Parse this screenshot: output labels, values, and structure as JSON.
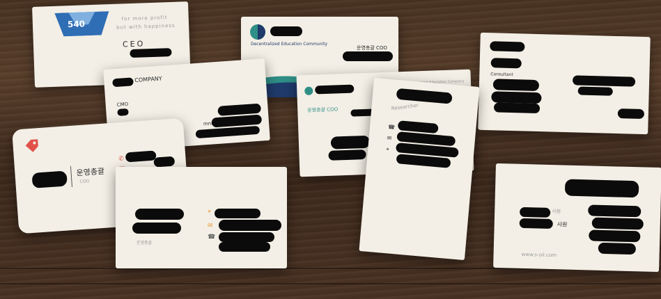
{
  "cards": {
    "card1": {
      "logo_text": "540",
      "role": "CEO",
      "slogan_1": "for more profit",
      "slogan_2": "but with happiness"
    },
    "card2": {
      "company_label": "COMPANY",
      "role": "CMO",
      "handle": "mnm"
    },
    "card3": {
      "org_caption": "Decentralized Education Community",
      "role": "운영총괄 COO"
    },
    "card4": {
      "role": "운영총괄 COO",
      "org_caption": "Decentralized Education Company"
    },
    "card5": {
      "role": "Researcher"
    },
    "card6": {
      "role": "Consultant"
    },
    "card7": {
      "role_ko": "운영총괄",
      "role_en": "COO"
    },
    "card8": {
      "role_ko": "운영총괄"
    },
    "card9": {
      "role_1": "사원",
      "role_2": "사원",
      "website": "www.s-oil.com"
    }
  },
  "colors": {
    "wood_dark": "#3f2a1d",
    "card_bg": "#f3efe6",
    "navy": "#1f3a6b",
    "teal": "#2f8f86",
    "coral": "#e0524a",
    "orange": "#e89a3c",
    "censor": "#0b0b0b"
  },
  "icons": [
    "tag-icon",
    "phone-icon",
    "email-icon",
    "location-icon",
    "wave-logo-icon"
  ]
}
